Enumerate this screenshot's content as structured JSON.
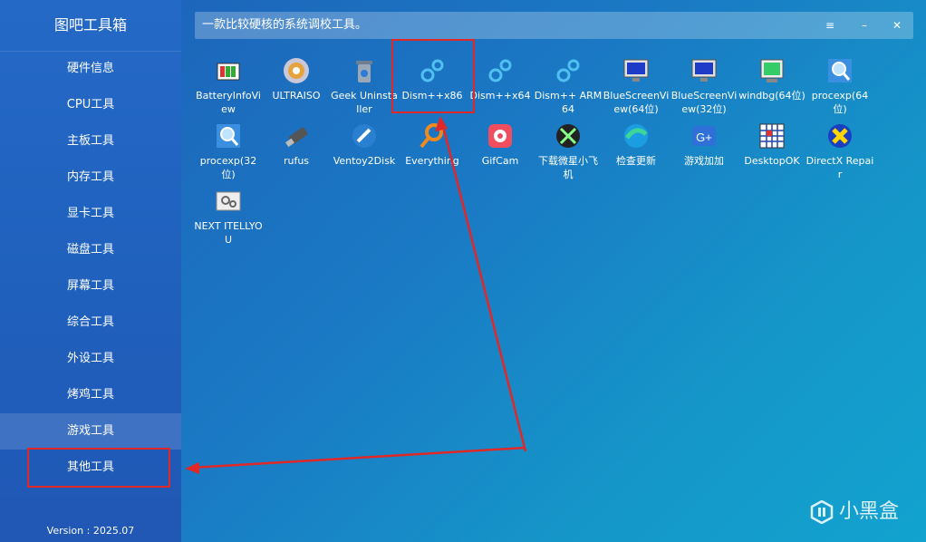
{
  "app": {
    "title": "图吧工具箱",
    "version": "Version : 2025.07"
  },
  "sidebar": {
    "items": [
      {
        "label": "硬件信息"
      },
      {
        "label": "CPU工具"
      },
      {
        "label": "主板工具"
      },
      {
        "label": "内存工具"
      },
      {
        "label": "显卡工具"
      },
      {
        "label": "磁盘工具"
      },
      {
        "label": "屏幕工具"
      },
      {
        "label": "综合工具"
      },
      {
        "label": "外设工具"
      },
      {
        "label": "烤鸡工具"
      },
      {
        "label": "游戏工具"
      },
      {
        "label": "其他工具"
      }
    ]
  },
  "topbar": {
    "description": "一款比较硬核的系统调校工具。",
    "menu_glyph": "≡",
    "min_glyph": "–",
    "close_glyph": "✕"
  },
  "tools": [
    {
      "label": "BatteryInfoView",
      "icon": "battery-icon"
    },
    {
      "label": "ULTRAISO",
      "icon": "disc-icon"
    },
    {
      "label": "Geek Uninstaller",
      "icon": "trash-icon"
    },
    {
      "label": "Dism++x86",
      "icon": "gears-icon"
    },
    {
      "label": "Dism++x64",
      "icon": "gears-icon"
    },
    {
      "label": "Dism++ ARM64",
      "icon": "gears-icon"
    },
    {
      "label": "BlueScreenView(64位)",
      "icon": "monitor-icon"
    },
    {
      "label": "BlueScreenView(32位)",
      "icon": "monitor-icon"
    },
    {
      "label": "windbg(64位)",
      "icon": "debugger-icon"
    },
    {
      "label": "procexp(64位)",
      "icon": "magnifier-icon"
    },
    {
      "label": "procexp(32位)",
      "icon": "magnifier-icon"
    },
    {
      "label": "rufus",
      "icon": "usb-icon"
    },
    {
      "label": "Ventoy2Disk",
      "icon": "ventoy-icon"
    },
    {
      "label": "Everything",
      "icon": "search-icon"
    },
    {
      "label": "GifCam",
      "icon": "camera-icon"
    },
    {
      "label": "下载微星小飞机",
      "icon": "afterburner-icon"
    },
    {
      "label": "检查更新",
      "icon": "edge-icon"
    },
    {
      "label": "游戏加加",
      "icon": "gameplus-icon"
    },
    {
      "label": "DesktopOK",
      "icon": "grid-icon"
    },
    {
      "label": "DirectX Repair",
      "icon": "directx-icon"
    },
    {
      "label": "NEXT ITELLYOU",
      "icon": "settings-icon"
    }
  ],
  "watermark": {
    "text": "小黑盒"
  },
  "colors": {
    "highlight": "#e02828",
    "sidebar": "#2163c0"
  }
}
